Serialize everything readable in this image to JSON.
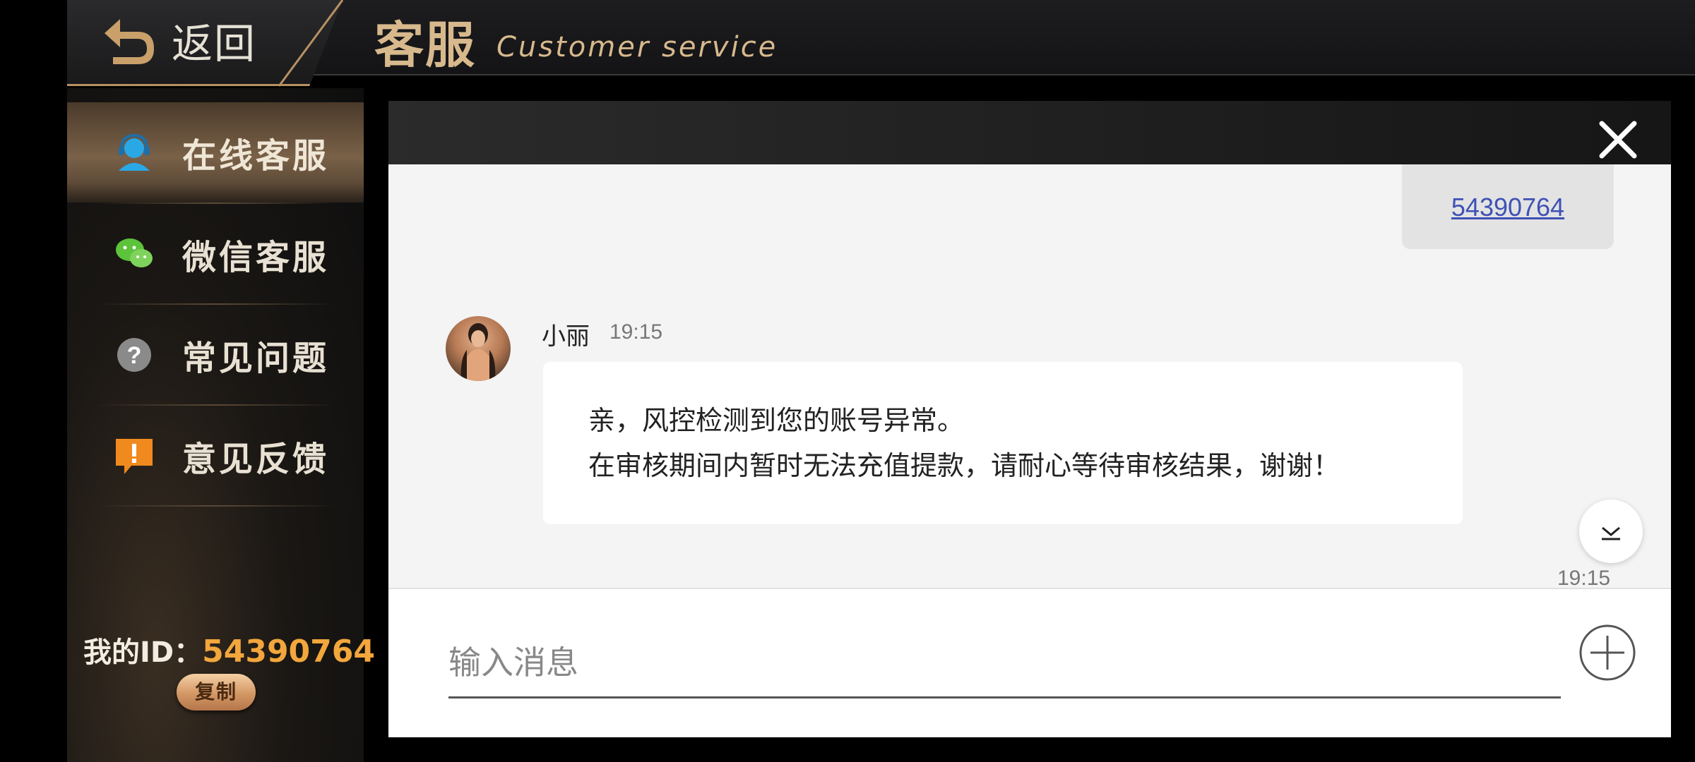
{
  "header": {
    "back_label": "返回",
    "title": "客服",
    "subtitle": "Customer service"
  },
  "sidebar": {
    "items": [
      {
        "label": "在线客服",
        "icon": "customer-service-icon",
        "active": true
      },
      {
        "label": "微信客服",
        "icon": "wechat-icon",
        "active": false
      },
      {
        "label": "常见问题",
        "icon": "question-icon",
        "active": false
      },
      {
        "label": "意见反馈",
        "icon": "feedback-icon",
        "active": false
      }
    ],
    "my_id_label": "我的ID：",
    "my_id_value": "54390764",
    "copy_label": "复制"
  },
  "chat": {
    "sent_message": "54390764",
    "agent_name": "小丽",
    "agent_time": "19:15",
    "message_line1": "亲，风控检测到您的账号异常。",
    "message_line2": "在审核期间内暂时无法充值提款，请耐心等待审核结果，谢谢！",
    "bottom_time": "19:15",
    "input_placeholder": "输入消息"
  },
  "colors": {
    "accent_gold": "#d8b98d",
    "id_orange": "#f2a63c",
    "link_blue": "#3f51b5"
  }
}
